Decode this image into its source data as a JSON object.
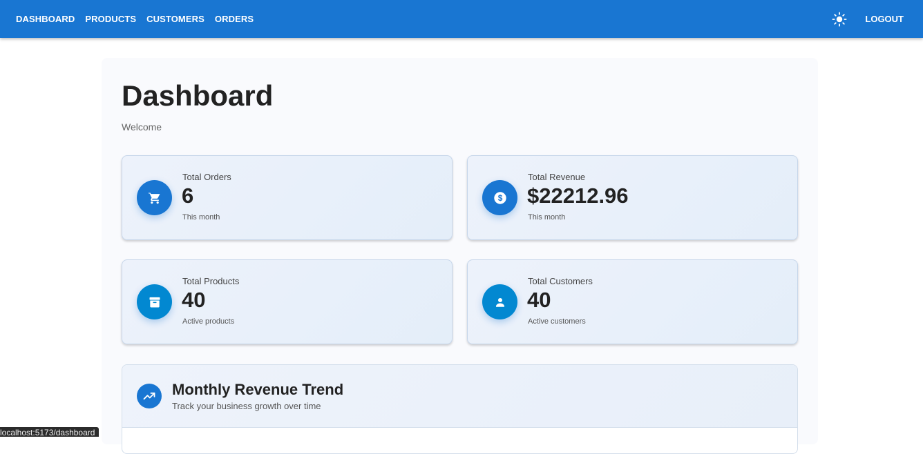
{
  "nav": {
    "items": [
      {
        "label": "DASHBOARD"
      },
      {
        "label": "PRODUCTS"
      },
      {
        "label": "CUSTOMERS"
      },
      {
        "label": "ORDERS"
      }
    ],
    "theme_icon": "sun-icon",
    "logout_label": "LOGOUT",
    "color": "#1976d2"
  },
  "page": {
    "title": "Dashboard",
    "subtitle": "Welcome"
  },
  "stats": [
    {
      "label": "Total Orders",
      "value": "6",
      "sub": "This month",
      "icon": "cart-icon",
      "color": "#1976d2"
    },
    {
      "label": "Total Revenue",
      "value": "$22212.96",
      "sub": "This month",
      "icon": "dollar-icon",
      "color": "#1976d2"
    },
    {
      "label": "Total Products",
      "value": "40",
      "sub": "Active products",
      "icon": "archive-icon",
      "color": "#0288d1"
    },
    {
      "label": "Total Customers",
      "value": "40",
      "sub": "Active customers",
      "icon": "person-icon",
      "color": "#0288d1"
    }
  ],
  "trend": {
    "title": "Monthly Revenue Trend",
    "subtitle": "Track your business growth over time",
    "icon": "trending-up-icon"
  },
  "status": {
    "url": "localhost:5173/dashboard"
  }
}
